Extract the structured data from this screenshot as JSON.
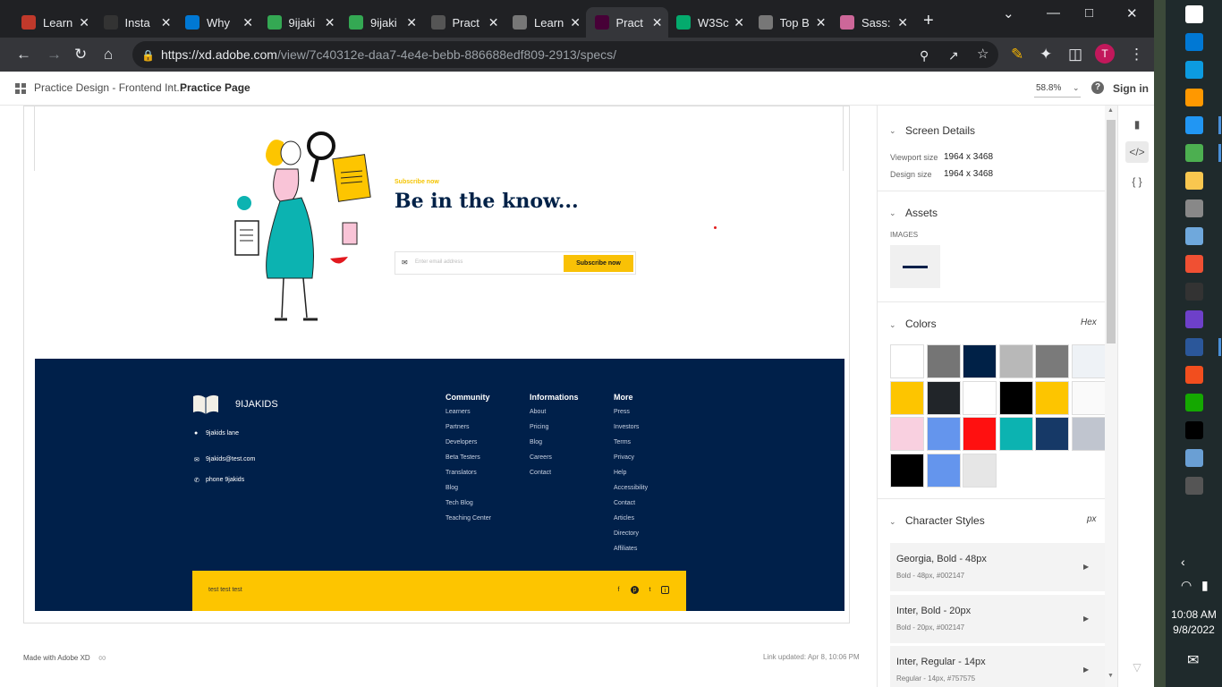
{
  "browser": {
    "tabs": [
      {
        "label": "Learn",
        "icon": "adobe-icon",
        "color": "#c0392b"
      },
      {
        "label": "Insta",
        "icon": "xd-insta-icon",
        "color": "#333"
      },
      {
        "label": "Why",
        "icon": "microsoft-icon",
        "color": "#0078d4"
      },
      {
        "label": "9ijaki",
        "icon": "maps-pin-icon",
        "color": "#34a853"
      },
      {
        "label": "9ijaki",
        "icon": "maps-pin-icon",
        "color": "#34a853"
      },
      {
        "label": "Pract",
        "icon": "github-icon",
        "color": "#555"
      },
      {
        "label": "Learn",
        "icon": "globe-icon",
        "color": "#777"
      },
      {
        "label": "Pract",
        "icon": "xd-icon",
        "color": "#470137"
      },
      {
        "label": "W3Sc",
        "icon": "w3schools-icon",
        "color": "#04aa6d"
      },
      {
        "label": "Top B",
        "icon": "globe-icon",
        "color": "#777"
      },
      {
        "label": "Sass:",
        "icon": "sass-icon",
        "color": "#cd6799"
      }
    ],
    "active_tab_index": 7,
    "url_host": "https://xd.adobe.com",
    "url_path": "/view/7c40312e-daa7-4e4e-bebb-886688edf809-2913/specs/",
    "avatar_letter": "T"
  },
  "xd": {
    "breadcrumb_project": "Practice Design - Frontend Int...",
    "breadcrumb_page": "Practice Page",
    "zoom": "58.8%",
    "sign_in": "Sign in",
    "made_with": "Made with Adobe XD",
    "link_updated": "Link updated: Apr 8, 10:06 PM"
  },
  "artboard": {
    "subscribe_eyebrow": "Subscribe now",
    "subscribe_title": "Be in the know...",
    "email_placeholder": "Enter email address",
    "subscribe_button": "Subscribe now",
    "brand": "9IJAKIDS",
    "contact": {
      "address": "9jakids lane",
      "email": "9jakids@test.com",
      "phone": "phone 9jakids"
    },
    "columns": [
      {
        "title": "Community",
        "items": [
          "Learners",
          "Partners",
          "Developers",
          "Beta Testers",
          "Translators",
          "Blog",
          "Tech Blog",
          "Teaching Center"
        ]
      },
      {
        "title": "Informations",
        "items": [
          "About",
          "Pricing",
          "Blog",
          "Careers",
          "Contact"
        ]
      },
      {
        "title": "More",
        "items": [
          "Press",
          "Investors",
          "Terms",
          "Privacy",
          "Help",
          "Accessibility",
          "Contact",
          "Articles",
          "Directory",
          "Affiliates"
        ]
      }
    ],
    "bottom_text": "test test test",
    "social": [
      "f",
      "p",
      "t",
      "i"
    ]
  },
  "panel": {
    "screen_details_title": "Screen Details",
    "viewport_label": "Viewport size",
    "viewport_value": "1964 x 3468",
    "design_label": "Design size",
    "design_value": "1964 x 3468",
    "assets_title": "Assets",
    "images_label": "IMAGES",
    "colors_title": "Colors",
    "colors_format": "Hex",
    "swatches": [
      "#ffffff",
      "#757575",
      "#002147",
      "#b8b8b8",
      "#7a7a7a",
      "#eef2f6",
      "#fdc500",
      "#212529",
      "#ffffff",
      "#000000",
      "#fdc500",
      "#fafafa",
      "#f9d0e0",
      "#6495ed",
      "#ff1010",
      "#0cb3b1",
      "#163967",
      "#c0c5cf",
      "#000000",
      "#6495ed",
      "#e6e6e6"
    ],
    "char_styles_title": "Character Styles",
    "char_styles_unit": "px",
    "char_styles": [
      {
        "name": "Georgia, Bold - 48px",
        "detail": "Bold - 48px, #002147"
      },
      {
        "name": "Inter, Bold - 20px",
        "detail": "Bold - 20px, #002147"
      },
      {
        "name": "Inter, Regular - 14px",
        "detail": "Regular - 14px, #757575"
      }
    ]
  },
  "taskbar": {
    "apps": [
      "start",
      "store",
      "edge",
      "sublime",
      "vscode",
      "chrome",
      "explorer",
      "pycharm-tool",
      "notepad",
      "git",
      "terminal",
      "github",
      "word",
      "figma",
      "upwork",
      "pycharm",
      "photos",
      "settings"
    ],
    "time": "10:08 AM",
    "date": "9/8/2022"
  }
}
